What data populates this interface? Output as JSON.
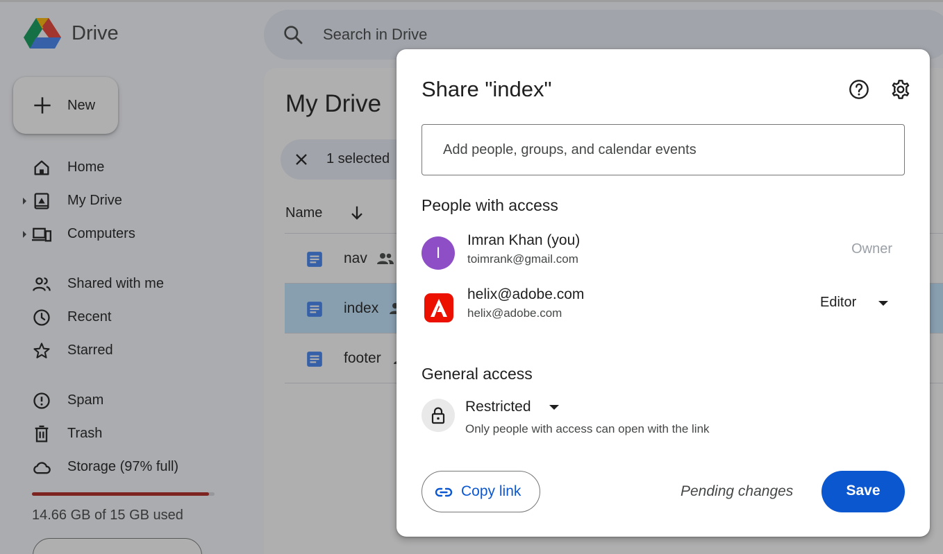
{
  "app": {
    "brand": "Drive",
    "search_placeholder": "Search in Drive",
    "new_label": "New",
    "nav": [
      {
        "label": "Home",
        "icon": "home-icon"
      },
      {
        "label": "My Drive",
        "icon": "my-drive-icon"
      },
      {
        "label": "Computers",
        "icon": "computers-icon"
      },
      {
        "label": "Shared with me",
        "icon": "shared-with-me-icon"
      },
      {
        "label": "Recent",
        "icon": "clock-icon"
      },
      {
        "label": "Starred",
        "icon": "star-icon"
      },
      {
        "label": "Spam",
        "icon": "spam-icon"
      },
      {
        "label": "Trash",
        "icon": "trash-icon"
      },
      {
        "label": "Storage (97% full)",
        "icon": "cloud-icon"
      }
    ],
    "storage": {
      "used_text": "14.66 GB of 15 GB used",
      "fraction": 0.97,
      "bar_color": "#b3261e"
    }
  },
  "main": {
    "title": "My Drive",
    "selection_text": "1 selected",
    "column_name": "Name",
    "files": [
      {
        "name": "nav",
        "selected": false
      },
      {
        "name": "index",
        "selected": true
      },
      {
        "name": "footer",
        "selected": false
      }
    ]
  },
  "dialog": {
    "title": "Share \"index\"",
    "add_placeholder": "Add people, groups, and calendar events",
    "people_heading": "People with access",
    "people": [
      {
        "initial": "I",
        "name": "Imran Khan (you)",
        "email": "toimrank@gmail.com",
        "role": "Owner",
        "avatar_color": "#8e4ec6"
      },
      {
        "name": "helix@adobe.com",
        "email": "helix@adobe.com",
        "role": "Editor",
        "avatar_icon": "adobe-logo-icon"
      }
    ],
    "general_heading": "General access",
    "access_level": "Restricted",
    "access_description": "Only people with access can open with the link",
    "copy_link_label": "Copy link",
    "pending_text": "Pending changes",
    "save_label": "Save",
    "accent_color": "#0b57d0"
  }
}
